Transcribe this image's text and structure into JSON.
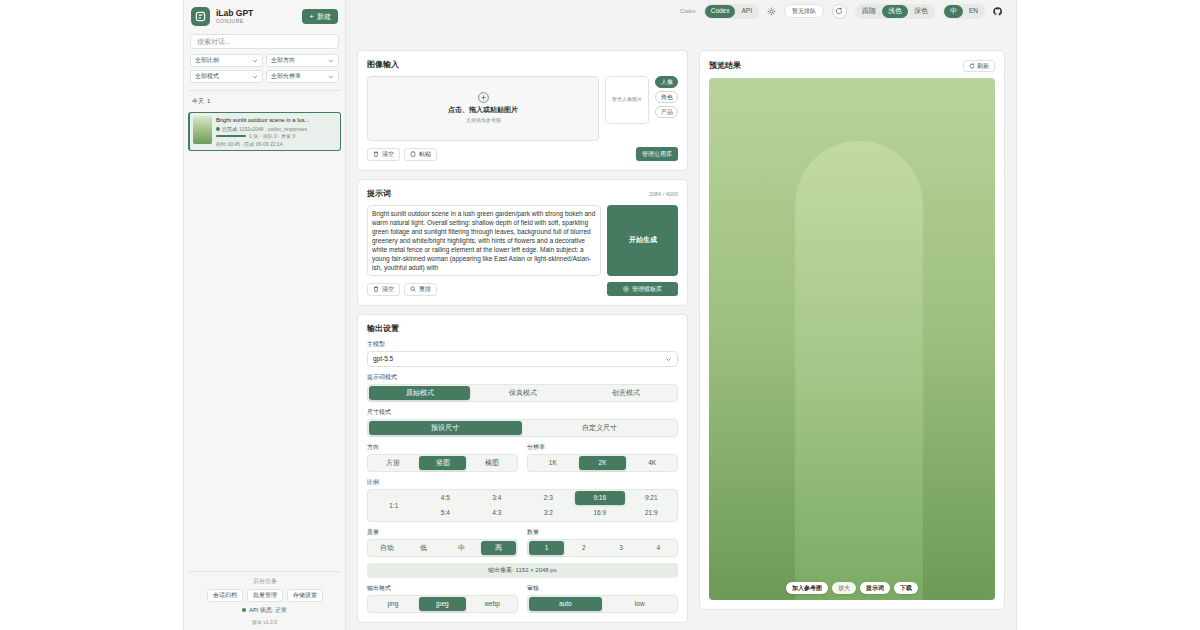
{
  "app": {
    "title": "iLab GPT",
    "subtitle": "CONJURE",
    "new_button": {
      "icon": "+",
      "label": "新建"
    }
  },
  "sidebar": {
    "search": {
      "placeholder": "搜索对话..."
    },
    "filters": [
      "全部比例",
      "全部方向",
      "全部模式",
      "全部分辨率"
    ],
    "group": {
      "label": "今天",
      "count": "1"
    },
    "conversations": [
      {
        "title": "Bright sunlit outdoor scene in a lus...",
        "status": "已完成",
        "meta": "1152x2048 · codex_responses",
        "level": 1,
        "stats": "1 张 · 排队 0 · 并发 0",
        "times": "耗时 00:45 · 完成 06-09 22:14",
        "selected": true
      }
    ],
    "footer": {
      "title": "后台任务",
      "buttons": [
        "会话归档",
        "批量管理",
        "存储设置"
      ],
      "api_status": "API 状态: 正常",
      "version": "版本 v1.0.5"
    }
  },
  "topbar": {
    "mode_label": "Codex",
    "modes": [
      {
        "label": "Codex",
        "selected": true
      },
      {
        "label": "API",
        "selected": false
      }
    ],
    "queue": "暂无排队",
    "themes": [
      {
        "label": "跟随",
        "selected": false
      },
      {
        "label": "浅色",
        "selected": true
      },
      {
        "label": "深色",
        "selected": false
      }
    ],
    "languages": [
      {
        "label": "中",
        "selected": true
      },
      {
        "label": "EN",
        "selected": false
      }
    ]
  },
  "image_input": {
    "title": "图像输入",
    "drop_title": "点击、拖入或粘贴图片",
    "drop_hint": "支持添加参考图",
    "portrait_empty": "暂无人像图片",
    "categories": [
      {
        "label": "人像",
        "selected": true
      },
      {
        "label": "角色",
        "selected": false
      },
      {
        "label": "产品",
        "selected": false
      }
    ],
    "actions": [
      "清空",
      "粘贴"
    ],
    "library_button": "管理公用库"
  },
  "prompt": {
    "title": "提示词",
    "count": "2084 / 4000",
    "text": "Bright sunlit outdoor scene in a lush green garden/park with strong bokeh and warm natural light. Overall setting: shallow depth of field with soft, sparkling green foliage and sunlight filtering through leaves, background full of blurred greenery and white/bright highlights, with hints of flowers and a decorative white metal fence or railing element at the lower left edge. Main subject: a young fair-skinned woman (appearing like East Asian or light-skinned/Asian-ish, youthful adult) with",
    "generate_button": "开始生成",
    "actions": [
      "清空",
      "重排"
    ],
    "template_button": "管理模板库"
  },
  "output": {
    "title": "输出设置",
    "model": {
      "label": "主模型",
      "value": "gpt-5.5"
    },
    "prompt_mode": {
      "label": "提示词模式",
      "options": [
        {
          "label": "原始模式",
          "selected": true
        },
        {
          "label": "保真模式",
          "selected": false
        },
        {
          "label": "创意模式",
          "selected": false
        }
      ]
    },
    "size_mode": {
      "label": "尺寸模式",
      "options": [
        {
          "label": "预设尺寸",
          "selected": true
        },
        {
          "label": "自定义尺寸",
          "selected": false
        }
      ]
    },
    "orientation": {
      "label": "方向",
      "options": [
        {
          "label": "方形",
          "selected": false
        },
        {
          "label": "竖图",
          "selected": true
        },
        {
          "label": "横图",
          "selected": false
        }
      ]
    },
    "resolution": {
      "label": "分辨率",
      "options": [
        {
          "label": "1K",
          "selected": false
        },
        {
          "label": "2K",
          "selected": true
        },
        {
          "label": "4K",
          "selected": false
        }
      ]
    },
    "ratio": {
      "label": "比例",
      "options": [
        {
          "label": "1:1",
          "selected": false
        },
        {
          "label": "4:5",
          "selected": false
        },
        {
          "label": "3:4",
          "selected": false
        },
        {
          "label": "2:3",
          "selected": false
        },
        {
          "label": "9:16",
          "selected": true
        },
        {
          "label": "9:21",
          "selected": false
        },
        {
          "label": "5:4",
          "selected": false
        },
        {
          "label": "4:3",
          "selected": false
        },
        {
          "label": "3:2",
          "selected": false
        },
        {
          "label": "16:9",
          "selected": false
        },
        {
          "label": "21:9",
          "selected": false
        }
      ]
    },
    "quality": {
      "label": "质量",
      "options": [
        {
          "label": "自动",
          "selected": false
        },
        {
          "label": "低",
          "selected": false
        },
        {
          "label": "中",
          "selected": false
        },
        {
          "label": "高",
          "selected": true
        }
      ]
    },
    "count": {
      "label": "数量",
      "options": [
        {
          "label": "1",
          "selected": true
        },
        {
          "label": "2",
          "selected": false
        },
        {
          "label": "3",
          "selected": false
        },
        {
          "label": "4",
          "selected": false
        }
      ]
    },
    "pixels": "输出像素: 1152 × 2048 px",
    "format": {
      "label": "输出格式",
      "options": [
        {
          "label": "png",
          "selected": false
        },
        {
          "label": "jpeg",
          "selected": true
        },
        {
          "label": "webp",
          "selected": false
        }
      ]
    },
    "moderation": {
      "label": "审核",
      "options": [
        {
          "label": "auto",
          "selected": true
        },
        {
          "label": "low",
          "selected": false
        }
      ]
    }
  },
  "preview": {
    "title": "预览结果",
    "refresh": "刷新",
    "actions": [
      "加入参考图",
      "放大",
      "提示词",
      "下载"
    ]
  }
}
